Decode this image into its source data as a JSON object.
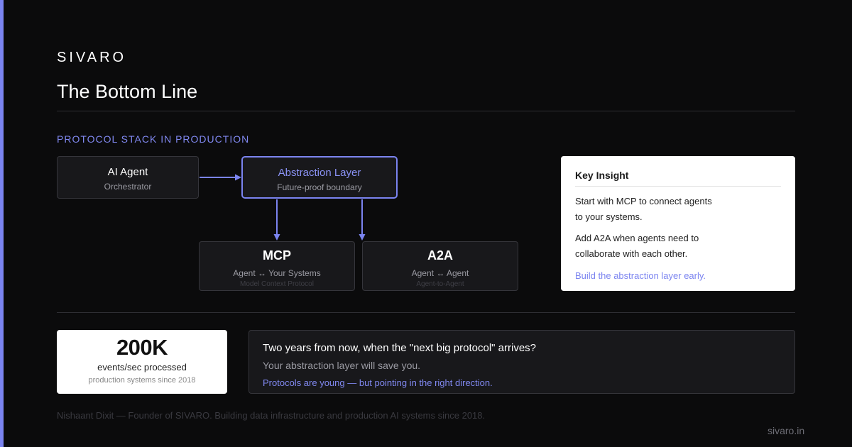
{
  "brand": "SIVARO",
  "title": "The Bottom Line",
  "section_label": "PROTOCOL STACK IN PRODUCTION",
  "diagram": {
    "agent": {
      "title": "AI Agent",
      "subtitle": "Orchestrator"
    },
    "abstraction": {
      "title": "Abstraction Layer",
      "subtitle": "Future-proof boundary"
    },
    "mcp": {
      "title": "MCP",
      "subtitle": "Agent ↔ Your Systems",
      "detail": "Model Context Protocol"
    },
    "a2a": {
      "title": "A2A",
      "subtitle": "Agent ↔ Agent",
      "detail": "Agent-to-Agent"
    }
  },
  "insight": {
    "heading": "Key Insight",
    "p1_line1": "Start with MCP to connect agents",
    "p1_line2": "to your systems.",
    "p2_line1": "Add A2A when agents need to",
    "p2_line2": "collaborate with each other.",
    "cta": "Build the abstraction layer early."
  },
  "stat": {
    "value": "200K",
    "label": "events/sec processed",
    "sub": "production systems since 2018"
  },
  "quote": {
    "main": "Two years from now, when the \"next big protocol\" arrives?",
    "sub": "Your abstraction layer will save you.",
    "accent": "Protocols are young — but pointing in the right direction."
  },
  "footer": {
    "note": "Nishaant Dixit — Founder of SIVARO. Building data infrastructure and production AI systems since 2018.",
    "url": "sivaro.in"
  },
  "colors": {
    "background": "#0b0b0c",
    "accent": "#7b84f0",
    "card_dark": "#18181b",
    "card_light": "#ffffff"
  }
}
